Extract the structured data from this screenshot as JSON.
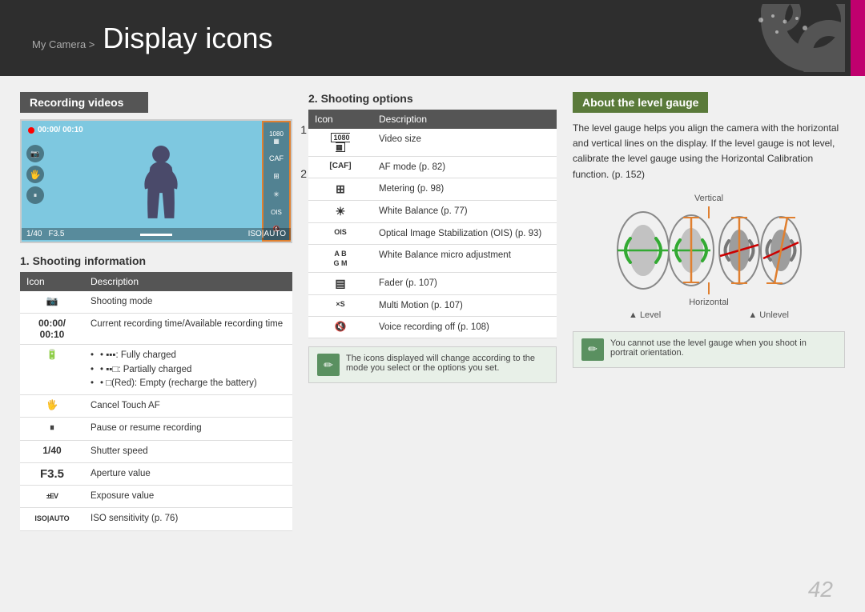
{
  "header": {
    "breadcrumb": "My Camera >",
    "title": "Display icons",
    "accent_color": "#c0006e"
  },
  "recording_videos": {
    "heading": "Recording videos",
    "camera_labels": {
      "label1": "1",
      "label2": "2"
    },
    "record_text": "● 00:00/ 00:10",
    "bottom_bar": "1/40   F3.5          ISO|AUTO"
  },
  "shooting_info": {
    "heading": "1. Shooting information",
    "col_icon": "Icon",
    "col_desc": "Description",
    "rows": [
      {
        "icon": "📷",
        "desc": "Shooting mode"
      },
      {
        "icon": "00:00/ 00:10",
        "desc": "Current recording time/Available recording time"
      },
      {
        "icon": "🔋",
        "desc": "• ▪▪▪: Fully charged\n• ▪▪□: Partially charged\n• □(Red): Empty (recharge the battery)"
      },
      {
        "icon": "🖐",
        "desc": "Cancel Touch AF"
      },
      {
        "icon": "⏸",
        "desc": "Pause or resume recording"
      },
      {
        "icon": "1/40",
        "desc": "Shutter speed"
      },
      {
        "icon": "F3.5",
        "desc": "Aperture value"
      },
      {
        "icon": "±EV",
        "desc": "Exposure value"
      },
      {
        "icon": "ISO|AUTO",
        "desc": "ISO sensitivity (p. 76)"
      }
    ]
  },
  "shooting_options": {
    "heading": "2. Shooting options",
    "col_icon": "Icon",
    "col_desc": "Description",
    "rows": [
      {
        "icon": "1080",
        "desc": "Video size"
      },
      {
        "icon": "CAF",
        "desc": "AF mode (p. 82)"
      },
      {
        "icon": "⊞",
        "desc": "Metering (p. 98)"
      },
      {
        "icon": "☀",
        "desc": "White Balance (p. 77)"
      },
      {
        "icon": "OIS",
        "desc": "Optical Image Stabilization (OIS) (p. 93)"
      },
      {
        "icon": "AB/GM",
        "desc": "White Balance micro adjustment"
      },
      {
        "icon": "▤",
        "desc": "Fader (p. 107)"
      },
      {
        "icon": "×5",
        "desc": "Multi Motion (p. 107)"
      },
      {
        "icon": "🎤",
        "desc": "Voice recording off (p. 108)"
      }
    ],
    "note": "The icons displayed will change according to the mode you select or the options you set."
  },
  "level_gauge": {
    "heading": "About the level gauge",
    "description": "The level gauge helps you align the camera with the horizontal and vertical lines on the display. If the level gauge is not level, calibrate the level gauge using the Horizontal Calibration function. (p. 152)",
    "label_vertical": "Vertical",
    "label_horizontal": "Horizontal",
    "label_level": "▲ Level",
    "label_unlevel": "▲ Unlevel",
    "note": "You cannot use the level gauge when you shoot in portrait orientation."
  },
  "page_number": "42"
}
